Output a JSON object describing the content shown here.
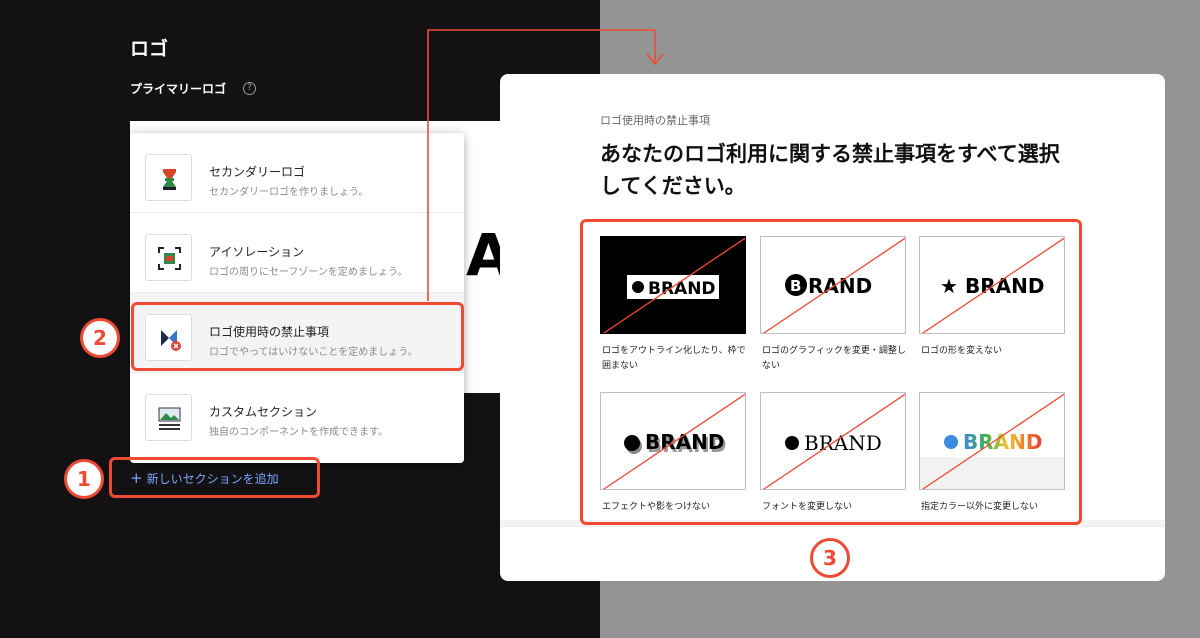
{
  "left": {
    "title": "ロゴ",
    "primary_logo_label": "プライマリーロゴ",
    "help_icon": "?",
    "brand_peek": "AI"
  },
  "menu": {
    "items": [
      {
        "title": "セカンダリーロゴ",
        "desc": "セカンダリーロゴを作りましょう。",
        "icon": "secondary-logo-icon"
      },
      {
        "title": "アイソレーション",
        "desc": "ロゴの周りにセーフゾーンを定めましょう。",
        "icon": "isolation-icon"
      },
      {
        "title": "ロゴ使用時の禁止事項",
        "desc": "ロゴでやってはいけないことを定めましょう。",
        "icon": "logo-misuse-icon"
      },
      {
        "title": "カスタムセクション",
        "desc": "独自のコンポーネントを作成できます。",
        "icon": "custom-section-icon"
      }
    ],
    "add_label": "新しいセクションを追加",
    "add_icon": "+"
  },
  "annotations": {
    "step1": "1",
    "step2": "2",
    "step3": "3",
    "highlight_color": "#ee4b35"
  },
  "modal": {
    "label": "ロゴ使用時の禁止事項",
    "question": "あなたのロゴ利用に関する禁止事項をすべて選択してください。",
    "rules": [
      {
        "caption": "ロゴをアウトライン化したり、枠で囲まない",
        "brand": "BRAND"
      },
      {
        "caption": "ロゴのグラフィックを変更・調整しない",
        "brand": "RAND",
        "brand_letter": "B"
      },
      {
        "caption": "ロゴの形を変えない",
        "brand": "BRAND",
        "star": "★"
      },
      {
        "caption": "エフェクトや影をつけない",
        "brand": "BRAND"
      },
      {
        "caption": "フォントを変更しない",
        "brand": "BRAND"
      },
      {
        "caption": "指定カラー以外に変更しない",
        "brand": "BRAND"
      }
    ]
  },
  "colors": {
    "dark_bg": "#131114",
    "gray_bg": "#949494",
    "link_blue": "#7da6ff",
    "accent_red": "#ee4b35"
  }
}
